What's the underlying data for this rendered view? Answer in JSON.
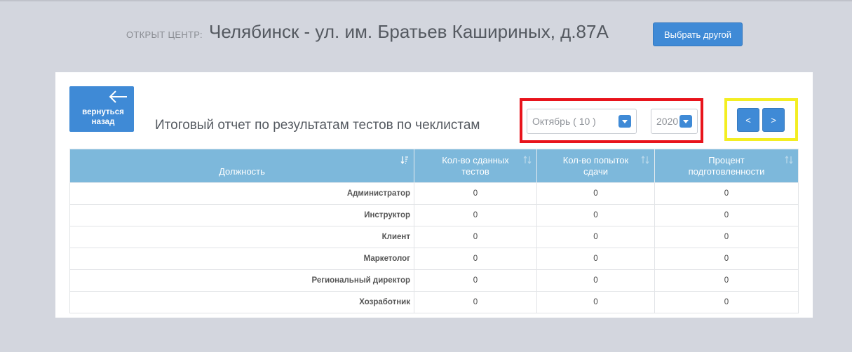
{
  "header": {
    "prefix": "ОТКРЫТ ЦЕНТР:",
    "center_name": "Челябинск - ул. им. Братьев Кашириных, д.87А",
    "choose_button": "Выбрать другой"
  },
  "back_button": {
    "label_line1": "вернуться",
    "label_line2": "назад",
    "icon": "arrow-left-icon"
  },
  "report_title": "Итоговый отчет по результатам тестов по чеклистам",
  "filters": {
    "month_selected": "Октябрь ( 10 )",
    "year_selected": "2020"
  },
  "pagination": {
    "prev_label": "<",
    "next_label": ">"
  },
  "table": {
    "columns": [
      "Должность",
      "Кол-во сданных тестов",
      "Кол-во попыток сдачи",
      "Процент подготовленности"
    ],
    "rows": [
      {
        "position": "Администратор",
        "tests_passed": "0",
        "attempts": "0",
        "percent": "0"
      },
      {
        "position": "Инструктор",
        "tests_passed": "0",
        "attempts": "0",
        "percent": "0"
      },
      {
        "position": "Клиент",
        "tests_passed": "0",
        "attempts": "0",
        "percent": "0"
      },
      {
        "position": "Маркетолог",
        "tests_passed": "0",
        "attempts": "0",
        "percent": "0"
      },
      {
        "position": "Региональный директор",
        "tests_passed": "0",
        "attempts": "0",
        "percent": "0"
      },
      {
        "position": "Хозработник",
        "tests_passed": "0",
        "attempts": "0",
        "percent": "0"
      }
    ]
  },
  "colors": {
    "accent": "#3f8ad6",
    "table_header": "#7db8db",
    "highlight_red": "#e8141c",
    "highlight_yellow": "#f3ee22",
    "background": "#d3d6de"
  }
}
